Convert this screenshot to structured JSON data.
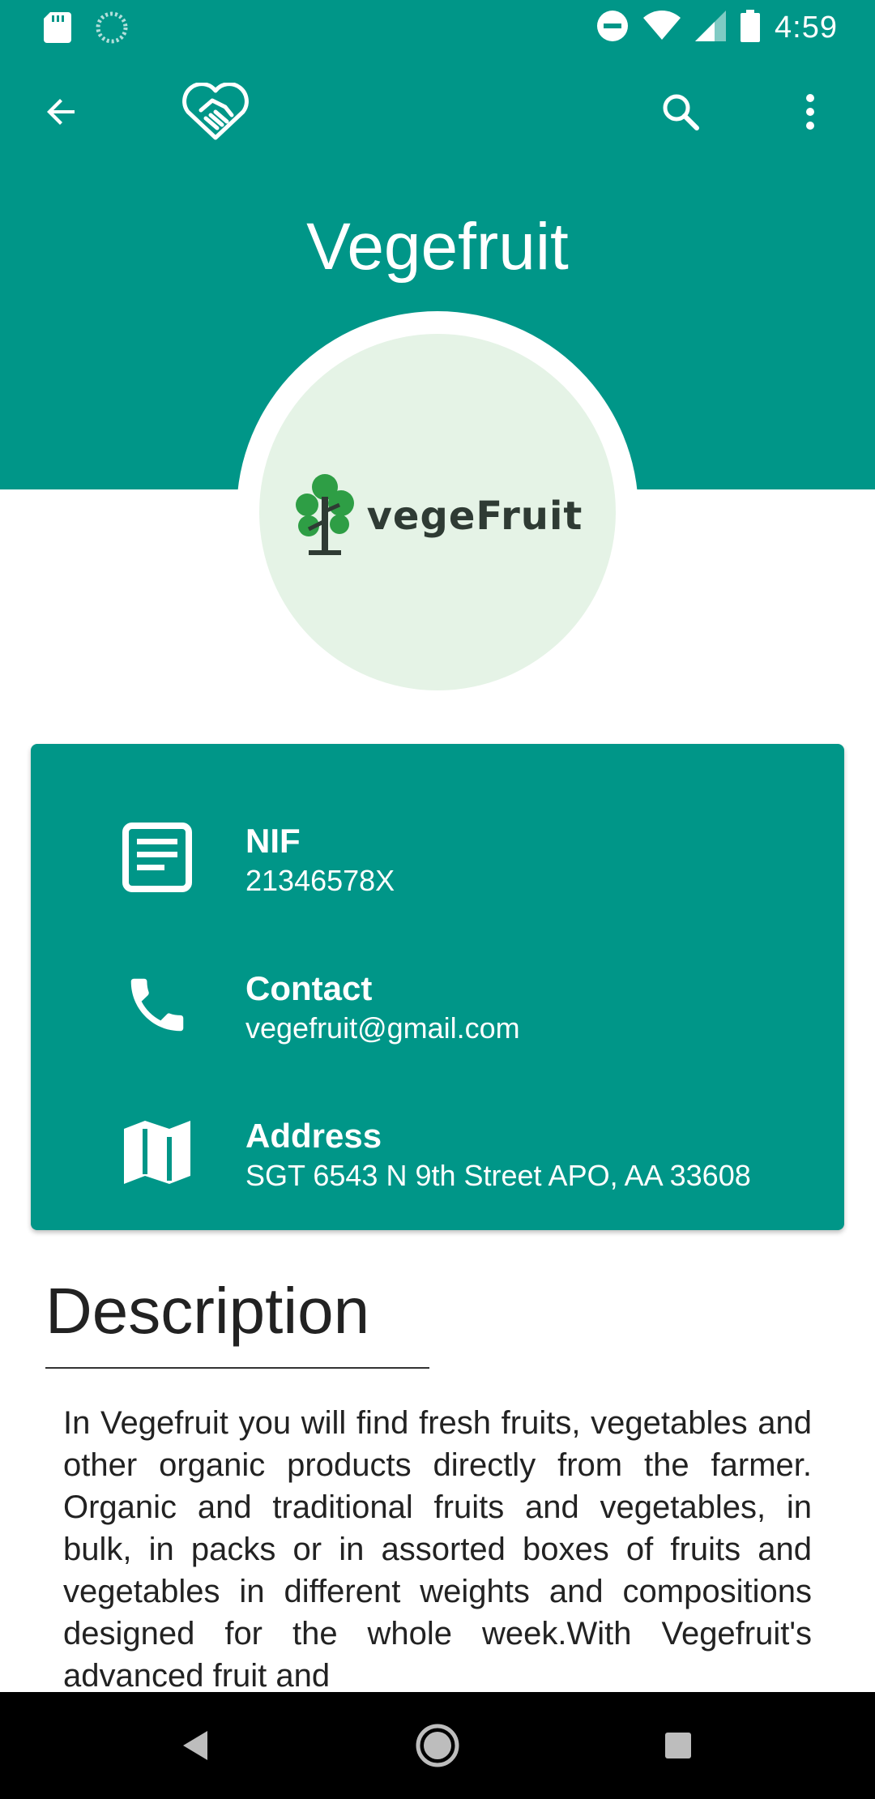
{
  "status_bar": {
    "time": "4:59",
    "icons": [
      "sd-card-icon",
      "sync-icon",
      "do-not-disturb-icon",
      "wifi-icon",
      "signal-icon",
      "battery-icon"
    ]
  },
  "app_bar": {
    "icons": [
      "back-arrow-icon",
      "handshake-heart-icon",
      "search-icon",
      "more-vert-icon"
    ]
  },
  "store": {
    "name": "Vegefruit",
    "logo_text": "vegeFruit"
  },
  "info": {
    "nif_label": "NIF",
    "nif_value": "21346578X",
    "contact_label": "Contact",
    "contact_value": "vegefruit@gmail.com",
    "address_label": "Address",
    "address_value": "SGT 6543 N 9th Street APO, AA 33608"
  },
  "description": {
    "title": "Description",
    "body": "In Vegefruit you will find fresh fruits, vegetables and other organic products directly from the farmer. Organic and traditional fruits and vegetables, in bulk, in packs or in assorted boxes of fruits and vegetables in different weights and compositions designed for the whole week.With Vegefruit's advanced fruit and"
  },
  "colors": {
    "primary": "#009688",
    "avatar_bg": "#e5f3e6",
    "logo_green": "#2e9e45"
  },
  "nav_bar": {
    "buttons": [
      "back-triangle-icon",
      "home-circle-icon",
      "recents-square-icon"
    ]
  }
}
